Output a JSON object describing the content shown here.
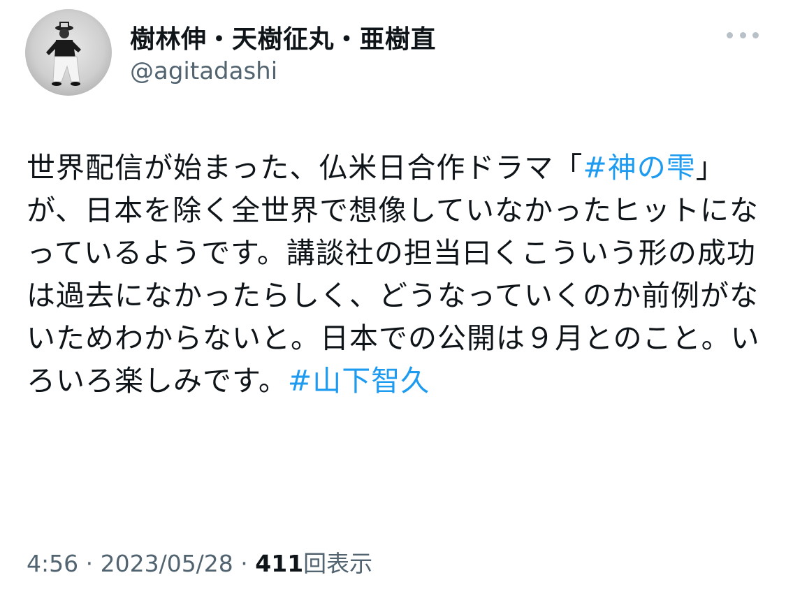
{
  "tweet": {
    "author": {
      "display_name": "樹林伸・天樹征丸・亜樹直",
      "handle": "@agitadashi"
    },
    "more_icon": "more-horizontal-icon",
    "text": {
      "seg1": "世界配信が始まった、仏米日合作ドラマ「",
      "hashtag1": "#神の雫",
      "seg2": "」が、日本を除く全世界で想像していなかったヒットになっているようです。講談社の担当曰くこういう形の成功は過去になかったらしく、どうなっていくのか前例がないためわからないと。日本での公開は９月とのこと。いろいろ楽しみです。",
      "hashtag2": "#山下智久"
    },
    "meta": {
      "time": "4:56",
      "sep1": " · ",
      "date": "2023/05/28",
      "sep2": " · ",
      "views_count": "411",
      "views_label": "回表示"
    },
    "colors": {
      "link": "#1d9bf0",
      "text": "#0f1419",
      "secondary": "#536471"
    }
  }
}
